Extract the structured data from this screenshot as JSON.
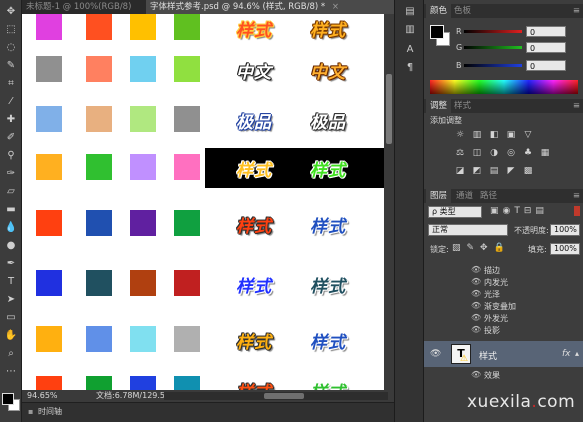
{
  "tabs": [
    {
      "label": "未标题-1 @ 100%(RGB/8)",
      "active": false
    },
    {
      "label": "字体样式参考.psd @ 94.6% (样式, RGB/8) *",
      "active": true
    }
  ],
  "canvas": {
    "color_squares": [
      [
        "#e040e0",
        "#ff5020",
        "#ffc000",
        "#60c020"
      ],
      [
        "#909090",
        "#ff8060",
        "#70d0f0",
        "#90e040"
      ],
      [
        "#80b0e8",
        "#e8b080",
        "#b0e880",
        "#909090"
      ],
      [
        "#ffb020",
        "#30c030",
        "#c090ff",
        "#ff70c0"
      ],
      [
        "#ff4010",
        "#2050b0",
        "#6020a0",
        "#10a040"
      ],
      [
        "#2030e0",
        "#205060",
        "#b04010",
        "#c02020"
      ],
      [
        "#ffb010",
        "#6090e8",
        "#80e0f0",
        "#b0b0b0"
      ],
      [
        "#ff4010",
        "#10a030",
        "#2040e0",
        "#1090b0"
      ]
    ],
    "styled_text": [
      {
        "text": "样式",
        "color": "#ff5020",
        "stroke": "#ffd040"
      },
      {
        "text": "样式",
        "color": "#ffb020",
        "stroke": "#7a3a00"
      },
      {
        "text": "中文",
        "color": "#ffffff",
        "stroke": "#202020"
      },
      {
        "text": "中文",
        "color": "#ffb030",
        "stroke": "#6a2a00"
      },
      {
        "text": "极品",
        "color": "#ffffff",
        "stroke": "#2040a0"
      },
      {
        "text": "极品",
        "color": "#ffffff",
        "stroke": "#303030"
      },
      {
        "text": "样式",
        "color": "#ffc020",
        "stroke": "#ffffff"
      },
      {
        "text": "样式",
        "color": "#40e020",
        "stroke": "#ffffff"
      },
      {
        "text": "样式",
        "color": "#ff4010",
        "stroke": "#303030"
      },
      {
        "text": "样式",
        "color": "#2050c0",
        "stroke": "#ffffff"
      },
      {
        "text": "样式",
        "color": "#2030ff",
        "stroke": "#ffffff"
      },
      {
        "text": "样式",
        "color": "#205060",
        "stroke": "#ffffff"
      },
      {
        "text": "样式",
        "color": "#ffb010",
        "stroke": "#303030"
      },
      {
        "text": "样式",
        "color": "#2050c0",
        "stroke": "#ffffff"
      },
      {
        "text": "样式",
        "color": "#ff5010",
        "stroke": "#303030"
      },
      {
        "text": "样式",
        "color": "#30c030",
        "stroke": "#ffffff"
      }
    ]
  },
  "status": {
    "zoom": "94.65%",
    "doc": "文档:6.78M/129.5M",
    "timeline": "时间轴"
  },
  "color_panel": {
    "tabs": [
      "颜色",
      "色板"
    ],
    "channels": [
      {
        "label": "R",
        "value": "0",
        "color": "#e02020"
      },
      {
        "label": "G",
        "value": "0",
        "color": "#20c020"
      },
      {
        "label": "B",
        "value": "0",
        "color": "#2040e0"
      }
    ]
  },
  "adjust_panel": {
    "tabs": [
      "调整",
      "样式"
    ],
    "title": "添加调整",
    "icons_row1": [
      "☼",
      "▥",
      "◧",
      "▣",
      "▽"
    ],
    "icons_row2": [
      "⚖",
      "◫",
      "◑",
      "◎",
      "♣",
      "▦"
    ],
    "icons_row3": [
      "◪",
      "◩",
      "▤",
      "◤",
      "▩"
    ]
  },
  "layers_panel": {
    "tabs": [
      "图层",
      "通道",
      "路径"
    ],
    "filter": "ρ 类型",
    "blend_mode": "正常",
    "opacity_label": "不透明度:",
    "opacity_value": "100%",
    "lock_label": "锁定:",
    "fill_label": "填充:",
    "fill_value": "100%",
    "effects": [
      "描边",
      "内发光",
      "光泽",
      "渐变叠加",
      "外发光",
      "投影"
    ],
    "layer_name": "样式",
    "fx": "fx",
    "sub_effects": "效果"
  },
  "watermark": {
    "left": "xuexila",
    "dot": ".",
    "right": "com"
  }
}
